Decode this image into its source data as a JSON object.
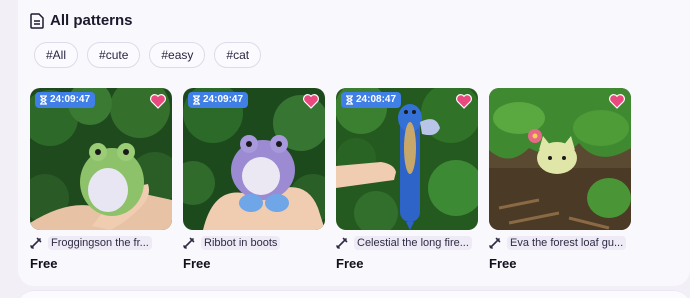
{
  "section": {
    "title": "All patterns",
    "icon": "document-icon"
  },
  "tags": [
    "#All",
    "#cute",
    "#easy",
    "#cat"
  ],
  "cards": [
    {
      "timer": "24:09:47",
      "name": "Froggingson the fr...",
      "price": "Free"
    },
    {
      "timer": "24:09:47",
      "name": "Ribbot in boots",
      "price": "Free"
    },
    {
      "timer": "24:08:47",
      "name": "Celestial the long fire...",
      "price": "Free"
    },
    {
      "timer": "",
      "name": "Eva the forest loaf gu...",
      "price": "Free"
    }
  ],
  "colors": {
    "accent": "#3f7fe6",
    "heart": "#e84a7f",
    "tag_bg": "#eeebf6"
  }
}
